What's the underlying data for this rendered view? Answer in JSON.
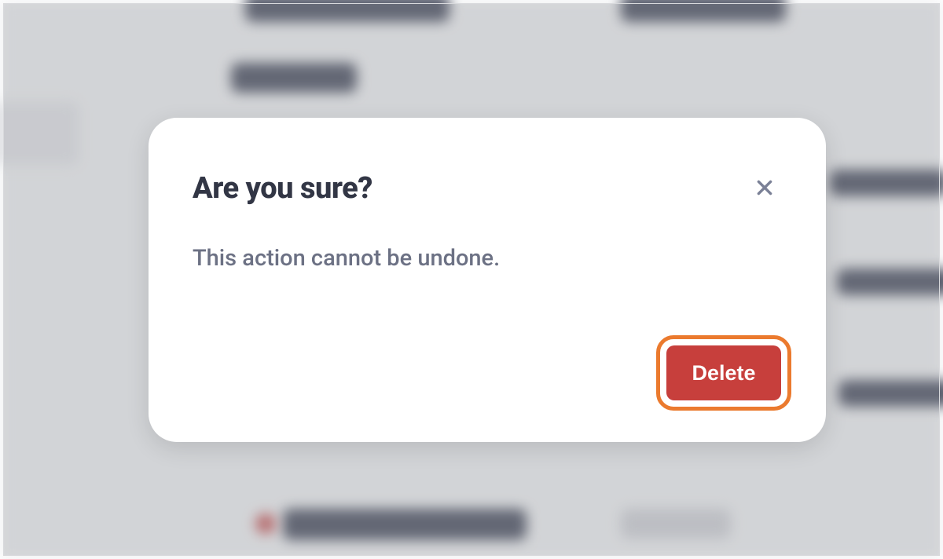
{
  "modal": {
    "title": "Are you sure?",
    "body": "This action cannot be undone.",
    "delete_label": "Delete"
  },
  "colors": {
    "accent_highlight": "#eb7a2e",
    "danger": "#c73f3c",
    "text_primary": "#323645",
    "text_secondary": "#6c7184",
    "close_icon": "#7a8096"
  }
}
